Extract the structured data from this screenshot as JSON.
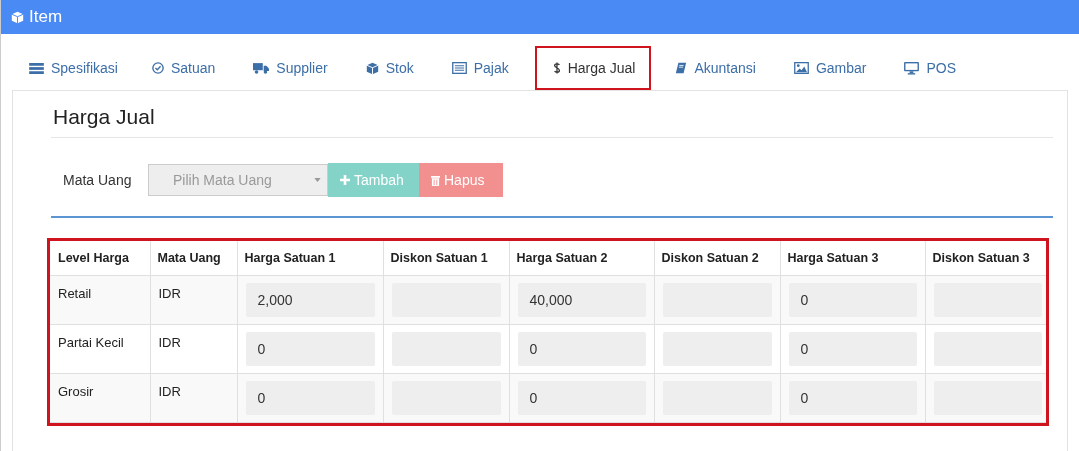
{
  "window": {
    "title": "Item"
  },
  "tabs": [
    {
      "label": "Spesifikasi",
      "selected": false
    },
    {
      "label": "Satuan",
      "selected": false
    },
    {
      "label": "Supplier",
      "selected": false
    },
    {
      "label": "Stok",
      "selected": false
    },
    {
      "label": "Pajak",
      "selected": false
    },
    {
      "label": "Harga Jual",
      "selected": true
    },
    {
      "label": "Akuntansi",
      "selected": false
    },
    {
      "label": "Gambar",
      "selected": false
    },
    {
      "label": "POS",
      "selected": false
    }
  ],
  "section_title": "Harga Jual",
  "currency_form": {
    "label": "Mata Uang",
    "placeholder": "Pilih Mata Uang",
    "add_button": "Tambah",
    "delete_button": "Hapus"
  },
  "table": {
    "highlighted": true,
    "columns": [
      "Level Harga",
      "Mata Uang",
      "Harga Satuan 1",
      "Diskon Satuan 1",
      "Harga Satuan 2",
      "Diskon Satuan 2",
      "Harga Satuan 3",
      "Diskon Satuan 3"
    ],
    "rows": [
      {
        "level": "Retail",
        "currency": "IDR",
        "prices": [
          "2,000",
          "40,000",
          "0"
        ]
      },
      {
        "level": "Partai Kecil",
        "currency": "IDR",
        "prices": [
          "0",
          "0",
          "0"
        ]
      },
      {
        "level": "Grosir",
        "currency": "IDR",
        "prices": [
          "0",
          "0",
          "0"
        ]
      }
    ]
  }
}
